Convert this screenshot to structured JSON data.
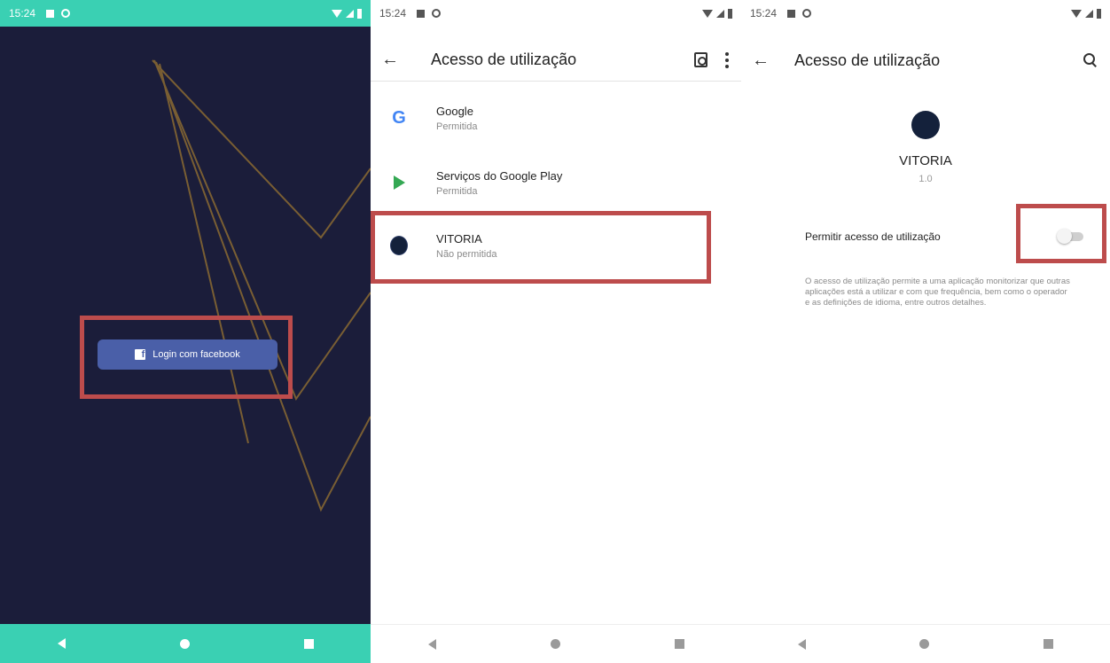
{
  "status_bar": {
    "time": "15:24"
  },
  "panel1": {
    "login_button": {
      "label": "Login com facebook",
      "logo": "f"
    }
  },
  "settings": {
    "title": "Acesso de utilização",
    "apps": [
      {
        "name": "Google",
        "status": "Permitida",
        "icon": "google-icon"
      },
      {
        "name": "Serviços do Google Play",
        "status": "Permitida",
        "icon": "google-play-services-icon"
      },
      {
        "name": "VITORIA",
        "status": "Não permitida",
        "icon": "vitoria-app-icon"
      }
    ]
  },
  "detail": {
    "title": "Acesso de utilização",
    "app_name": "VITORIA",
    "version": "1.0",
    "permission_label": "Permitir acesso de utilização",
    "permission_enabled": false,
    "description": "O acesso de utilização permite a uma aplicação monitorizar que outras aplicações está a utilizar e com que frequência, bem como o operador e as definições de idioma, entre outros detalhes."
  },
  "colors": {
    "accent": "#3ad0b3",
    "dark_background": "#1b1d3a",
    "facebook_button": "#4a5fa8",
    "highlight_border": "#bd4c4c",
    "decorative_lines": "#8a6a32"
  }
}
